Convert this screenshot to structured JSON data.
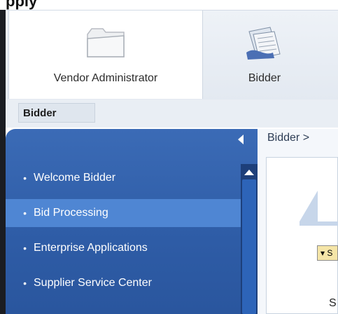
{
  "header": {
    "cut_title": "pply"
  },
  "roles": [
    {
      "label": "Vendor Administrator",
      "icon": "folder-icon",
      "active": true
    },
    {
      "label": "Bidder",
      "icon": "documents-icon",
      "active": false
    }
  ],
  "subtab": {
    "label": "Bidder"
  },
  "nav": {
    "items": [
      {
        "label": "Welcome Bidder",
        "selected": false
      },
      {
        "label": "Bid Processing",
        "selected": true
      },
      {
        "label": "Enterprise Applications",
        "selected": false
      },
      {
        "label": "Supplier Service Center",
        "selected": false
      }
    ],
    "bullet": "•"
  },
  "content": {
    "breadcrumb": "Bidder  >",
    "dropdown_label": "▾ S",
    "cut_letter": "S"
  },
  "colors": {
    "nav_bg": "#2e5ca6",
    "nav_selected": "#4f86d3",
    "dropdown_bg": "#f5e5a7"
  }
}
